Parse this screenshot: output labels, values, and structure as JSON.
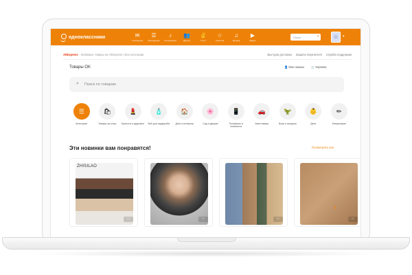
{
  "app": {
    "logo_text": "одноклассники"
  },
  "nav": [
    {
      "icon": "✉",
      "label": "Сообщения"
    },
    {
      "icon": "☰",
      "label": "Обсуждения"
    },
    {
      "icon": "♪",
      "label": "Оповещения"
    },
    {
      "icon": "👥",
      "label": "Друзья"
    },
    {
      "icon": "✌",
      "label": "Гости"
    },
    {
      "icon": "☆",
      "label": "События"
    },
    {
      "icon": "♫",
      "label": "Музыка"
    },
    {
      "icon": "▶",
      "label": "Видео"
    }
  ],
  "search": {
    "placeholder": "Поиск"
  },
  "subbar": {
    "aliexpress": "AliExpress",
    "breadcrumb": "Любимые товары на AliExpress | Все категории",
    "links": [
      "Быстрая доставка",
      "Защита покупателя",
      "Служба поддержки"
    ]
  },
  "shop": {
    "title": "Товары OK",
    "links": [
      "Мои заказы",
      "Корзина"
    ],
    "search_placeholder": "Поиск по товарам"
  },
  "categories": [
    {
      "icon": "☰",
      "label": "Категории"
    },
    {
      "icon": "🛍",
      "label": "Товары за грош"
    },
    {
      "icon": "💄",
      "label": "Красота и здоровье"
    },
    {
      "icon": "🧴",
      "label": "Всё для гардероба"
    },
    {
      "icon": "🏠",
      "label": "Дом и интерьер"
    },
    {
      "icon": "🌸",
      "label": "Сад и дворик"
    },
    {
      "icon": "📱",
      "label": "Телефоны и планшеты"
    },
    {
      "icon": "🚗",
      "label": "Автотовары"
    },
    {
      "icon": "🦖",
      "label": "Игры и игрушки"
    },
    {
      "icon": "👶",
      "label": "Дети"
    },
    {
      "icon": "✏",
      "label": "Канцелярия"
    }
  ],
  "section": {
    "title": "Эти новинки вам понравятся!",
    "link": "Посмотреть все"
  },
  "products": [
    {
      "brand": "ZHISILAO"
    },
    {
      "brand": ""
    },
    {
      "brand": ""
    },
    {
      "brand": ""
    }
  ],
  "colors": {
    "brand": "#ee8208",
    "aliexpress": "#e62e04"
  }
}
